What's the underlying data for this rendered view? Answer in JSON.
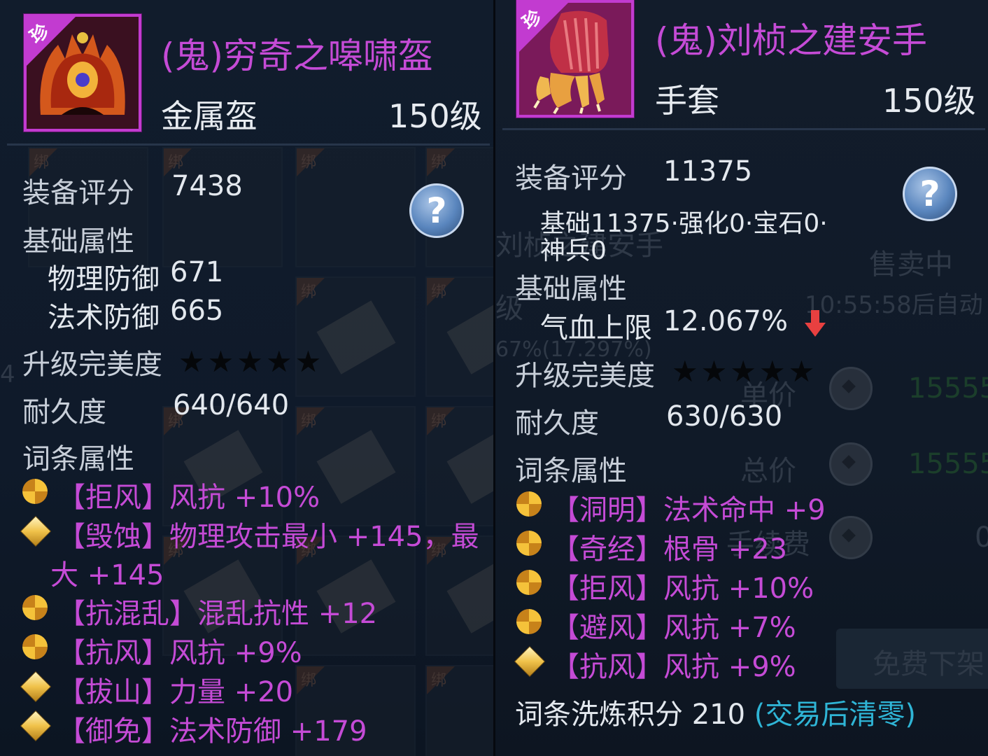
{
  "left": {
    "rarity_badge": "珍",
    "name": "(鬼)穷奇之嗥啸盔",
    "type": "金属盔",
    "level": "150级",
    "score_label": "装备评分",
    "score": "7438",
    "base_label": "基础属性",
    "base_stats": [
      {
        "name": "物理防御",
        "value": "671"
      },
      {
        "name": "法术防御",
        "value": "665"
      }
    ],
    "perfection_label": "升级完美度",
    "perfection_stars": 5,
    "durability_label": "耐久度",
    "durability": "640/640",
    "affix_label": "词条属性",
    "affixes": [
      {
        "icon": "swirl-icon",
        "tag": "【拒风】",
        "text": "风抗 +10%"
      },
      {
        "icon": "diamond-icon",
        "tag": "【毁蚀】",
        "text": "物理攻击最小 +145，最",
        "text2": "大 +145"
      },
      {
        "icon": "swirl-icon",
        "tag": "【抗混乱】",
        "text": "混乱抗性 +12"
      },
      {
        "icon": "swirl-icon",
        "tag": "【抗风】",
        "text": "风抗 +9%"
      },
      {
        "icon": "diamond-icon",
        "tag": "【拔山】",
        "text": "力量 +20"
      },
      {
        "icon": "diamond-icon",
        "tag": "【御免】",
        "text": "法术防御 +179"
      }
    ],
    "help": "?"
  },
  "right": {
    "rarity_badge": "珍",
    "name": "(鬼)刘桢之建安手",
    "type": "手套",
    "level": "150级",
    "score_label": "装备评分",
    "score": "11375",
    "score_breakdown_1": "基础11375·强化0·宝石0·",
    "score_breakdown_2": "神兵0",
    "base_label": "基础属性",
    "base_stats": [
      {
        "name": "气血上限",
        "value": "12.067%"
      }
    ],
    "perfection_label": "升级完美度",
    "perfection_stars": 5,
    "durability_label": "耐久度",
    "durability": "630/630",
    "affix_label": "词条属性",
    "affixes": [
      {
        "icon": "swirl-icon",
        "tag": "【洞明】",
        "text": "法术命中 +9"
      },
      {
        "icon": "swirl-icon",
        "tag": "【奇经】",
        "text": "根骨 +23"
      },
      {
        "icon": "swirl-icon",
        "tag": "【拒风】",
        "text": "风抗 +10%"
      },
      {
        "icon": "swirl-icon",
        "tag": "【避风】",
        "text": "风抗 +7%"
      },
      {
        "icon": "diamond-icon",
        "tag": "【抗风】",
        "text": "风抗 +9%"
      }
    ],
    "refine_label": "词条洗炼积分 210",
    "refine_note": "(交易后清零)",
    "help": "?"
  },
  "background": {
    "bind_tag": "绑",
    "ghost_title": "刘桢之建安手",
    "ghost_level": "级",
    "selling": "售卖中",
    "countdown": "10:55:58后自动",
    "ghost_stat": "67%(17.297%)",
    "unit_price_label": "单价",
    "unit_price": "15555",
    "total_price_label": "总价",
    "total_price": "15555",
    "fee_label": "手续费",
    "fee": "0",
    "delist_button": "免费下架",
    "left_edge_digit": "4"
  },
  "colors": {
    "purple": "#c54bd6",
    "cyan": "#2fb5d6",
    "star": "#05070a",
    "down_arrow": "#e84040"
  }
}
